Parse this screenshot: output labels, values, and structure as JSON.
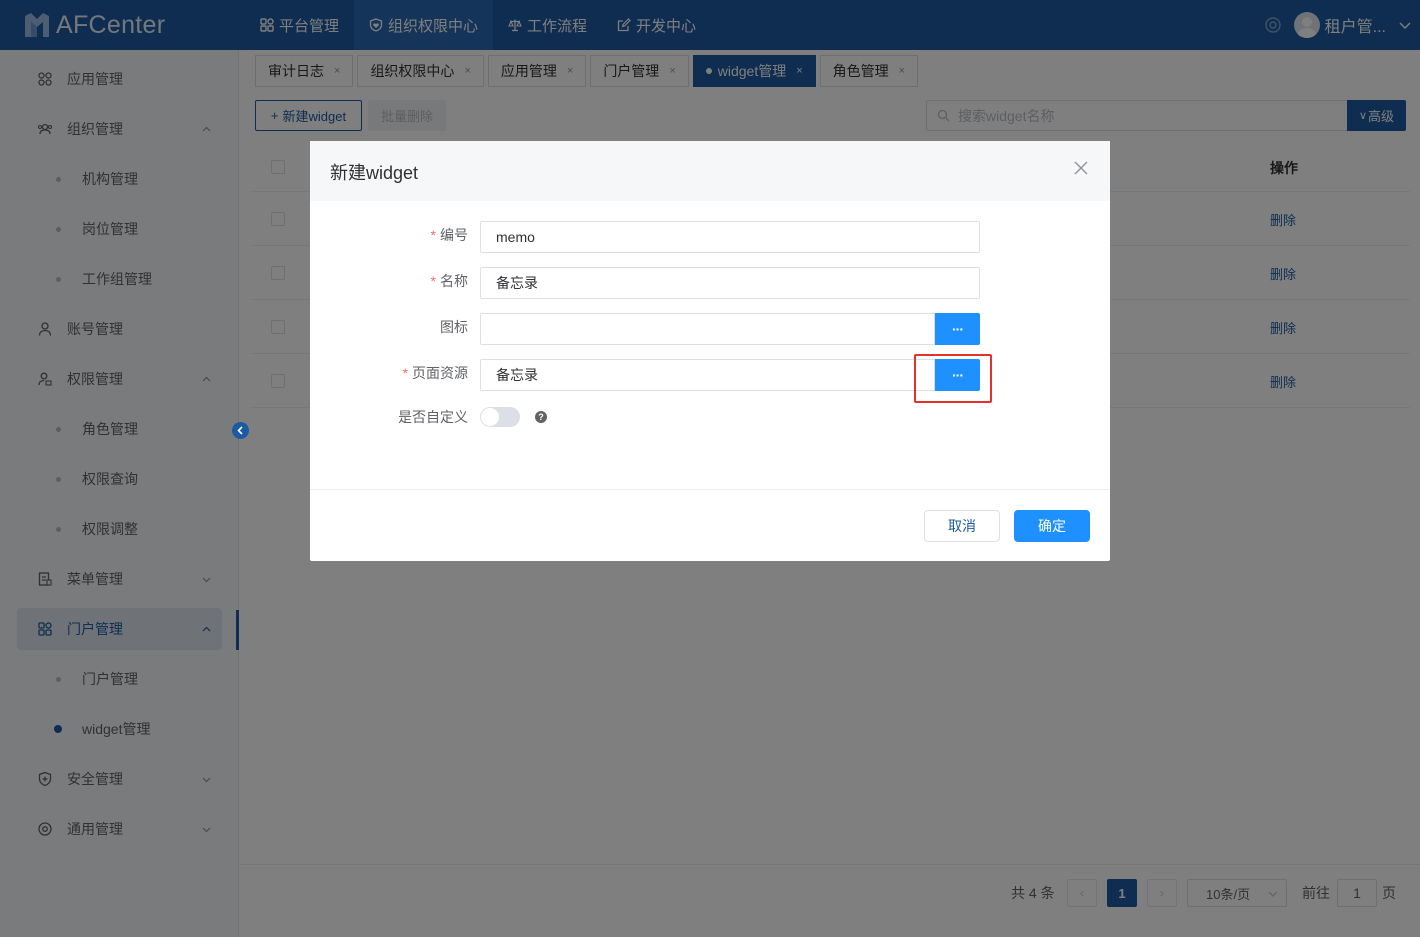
{
  "app": {
    "name": "AFCenter"
  },
  "topnav": [
    {
      "label": "平台管理",
      "icon": "grid-icon"
    },
    {
      "label": "组织权限中心",
      "icon": "shield-heart-icon"
    },
    {
      "label": "工作流程",
      "icon": "scale-icon"
    },
    {
      "label": "开发中心",
      "icon": "edit-icon"
    }
  ],
  "user": {
    "name": "租户管..."
  },
  "sidebar": {
    "items": [
      {
        "label": "应用管理"
      },
      {
        "label": "组织管理"
      },
      {
        "label": "机构管理"
      },
      {
        "label": "岗位管理"
      },
      {
        "label": "工作组管理"
      },
      {
        "label": "账号管理"
      },
      {
        "label": "权限管理"
      },
      {
        "label": "角色管理"
      },
      {
        "label": "权限查询"
      },
      {
        "label": "权限调整"
      },
      {
        "label": "菜单管理"
      },
      {
        "label": "门户管理"
      },
      {
        "label": "门户管理"
      },
      {
        "label": "widget管理"
      },
      {
        "label": "安全管理"
      },
      {
        "label": "通用管理"
      }
    ]
  },
  "tabs": [
    {
      "label": "审计日志"
    },
    {
      "label": "组织权限中心"
    },
    {
      "label": "应用管理"
    },
    {
      "label": "门户管理"
    },
    {
      "label": "widget管理"
    },
    {
      "label": "角色管理"
    }
  ],
  "toolbar": {
    "new_label": "新建widget",
    "batch_delete_label": "批量删除",
    "search_placeholder": "搜索widget名称",
    "advanced_label": "高级"
  },
  "table": {
    "ops_header": "操作",
    "rows": [
      {
        "action": "删除"
      },
      {
        "action": "删除"
      },
      {
        "action": "删除"
      },
      {
        "action": "删除"
      }
    ]
  },
  "pagination": {
    "total": "共 4 条",
    "current": "1",
    "page_size": "10条/页",
    "goto_label": "前往",
    "goto_value": "1",
    "page_suffix": "页"
  },
  "dialog": {
    "title": "新建widget",
    "fields": {
      "code_label": "编号",
      "code_value": "memo",
      "name_label": "名称",
      "name_value": "备忘录",
      "icon_label": "图标",
      "icon_value": "",
      "page_label": "页面资源",
      "page_value": "备忘录",
      "custom_label": "是否自定义"
    },
    "more_button": "···",
    "cancel_label": "取消",
    "confirm_label": "确定"
  },
  "colors": {
    "brand": "#1c5aa3",
    "primary_button": "#1e90ff",
    "highlight": "#e5312c"
  }
}
